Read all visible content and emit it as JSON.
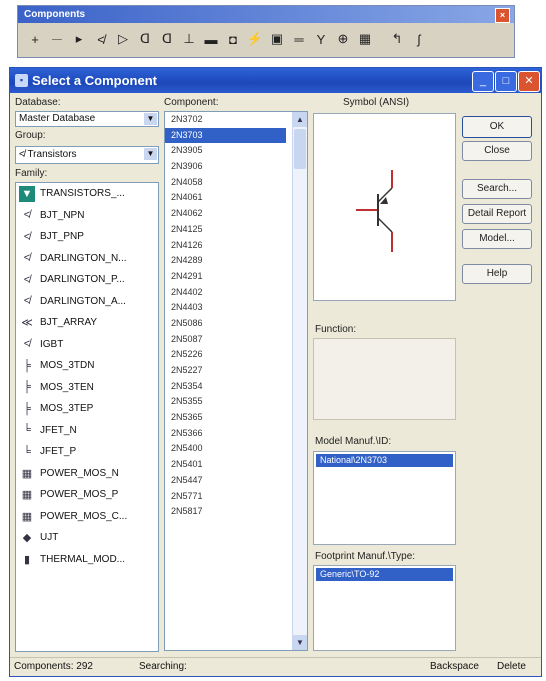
{
  "toolbar": {
    "title": "Components",
    "close_glyph": "×",
    "icons": [
      {
        "name": "source-icon",
        "glyph": "+"
      },
      {
        "name": "basic-icon",
        "glyph": "⏤"
      },
      {
        "name": "diode-icon",
        "glyph": "▸"
      },
      {
        "name": "transistor-icon",
        "glyph": "≮"
      },
      {
        "name": "analog-icon",
        "glyph": "▷"
      },
      {
        "name": "ttl-icon",
        "glyph": "ᗡ"
      },
      {
        "name": "cmos-icon",
        "glyph": "ᗡ"
      },
      {
        "name": "misc-digital-icon",
        "glyph": "⊥"
      },
      {
        "name": "mixed-icon",
        "glyph": "▬"
      },
      {
        "name": "indicator-icon",
        "glyph": "◘"
      },
      {
        "name": "power-icon",
        "glyph": "⚡"
      },
      {
        "name": "misc-icon",
        "glyph": "▣"
      },
      {
        "name": "advanced-periph-icon",
        "glyph": "═"
      },
      {
        "name": "rf-icon",
        "glyph": "Y"
      },
      {
        "name": "electromech-icon",
        "glyph": "⊕"
      },
      {
        "name": "mcu-icon",
        "glyph": "▦"
      },
      {
        "name": "hierarchy-icon",
        "glyph": "↰"
      },
      {
        "name": "bus-icon",
        "glyph": "ʃ"
      }
    ]
  },
  "dialog": {
    "title": "Select a Component",
    "minimize_glyph": "_",
    "maximize_glyph": "□",
    "close_glyph": "✕",
    "database_label": "Database:",
    "database_value": "Master Database",
    "group_label": "Group:",
    "group_value": "Transistors",
    "family_label": "Family:",
    "component_label": "Component:",
    "symbol_label": "Symbol (ANSI)",
    "function_label": "Function:",
    "model_label": "Model Manuf.\\ID:",
    "model_value": "National\\2N3703",
    "footprint_label": "Footprint Manuf.\\Type:",
    "footprint_value": "Generic\\TO-92",
    "families": [
      {
        "label": "TRANSISTORS_...",
        "icon": "▼"
      },
      {
        "label": "BJT_NPN",
        "icon": "≮"
      },
      {
        "label": "BJT_PNP",
        "icon": "≮"
      },
      {
        "label": "DARLINGTON_N...",
        "icon": "≮"
      },
      {
        "label": "DARLINGTON_P...",
        "icon": "≮"
      },
      {
        "label": "DARLINGTON_A...",
        "icon": "≮"
      },
      {
        "label": "BJT_ARRAY",
        "icon": "≪"
      },
      {
        "label": "IGBT",
        "icon": "≮"
      },
      {
        "label": "MOS_3TDN",
        "icon": "╞"
      },
      {
        "label": "MOS_3TEN",
        "icon": "╞"
      },
      {
        "label": "MOS_3TEP",
        "icon": "╞"
      },
      {
        "label": "JFET_N",
        "icon": "╘"
      },
      {
        "label": "JFET_P",
        "icon": "╘"
      },
      {
        "label": "POWER_MOS_N",
        "icon": "▦"
      },
      {
        "label": "POWER_MOS_P",
        "icon": "▦"
      },
      {
        "label": "POWER_MOS_C...",
        "icon": "▦"
      },
      {
        "label": "UJT",
        "icon": "◆"
      },
      {
        "label": "THERMAL_MOD...",
        "icon": "▮"
      }
    ],
    "components": [
      "2N3702",
      "2N3703",
      "2N3905",
      "2N3906",
      "2N4058",
      "2N4061",
      "2N4062",
      "2N4125",
      "2N4126",
      "2N4289",
      "2N4291",
      "2N4402",
      "2N4403",
      "2N5086",
      "2N5087",
      "2N5226",
      "2N5227",
      "2N5354",
      "2N5355",
      "2N5365",
      "2N5366",
      "2N5400",
      "2N5401",
      "2N5447",
      "2N5771",
      "2N5817"
    ],
    "selected_component": "2N3703",
    "buttons": {
      "ok": "OK",
      "close": "Close",
      "search": "Search...",
      "detail": "Detail Report",
      "model": "Model...",
      "help": "Help"
    },
    "status": {
      "components": "Components: 292",
      "searching": "Searching:",
      "backspace": "Backspace",
      "delete": "Delete"
    }
  }
}
